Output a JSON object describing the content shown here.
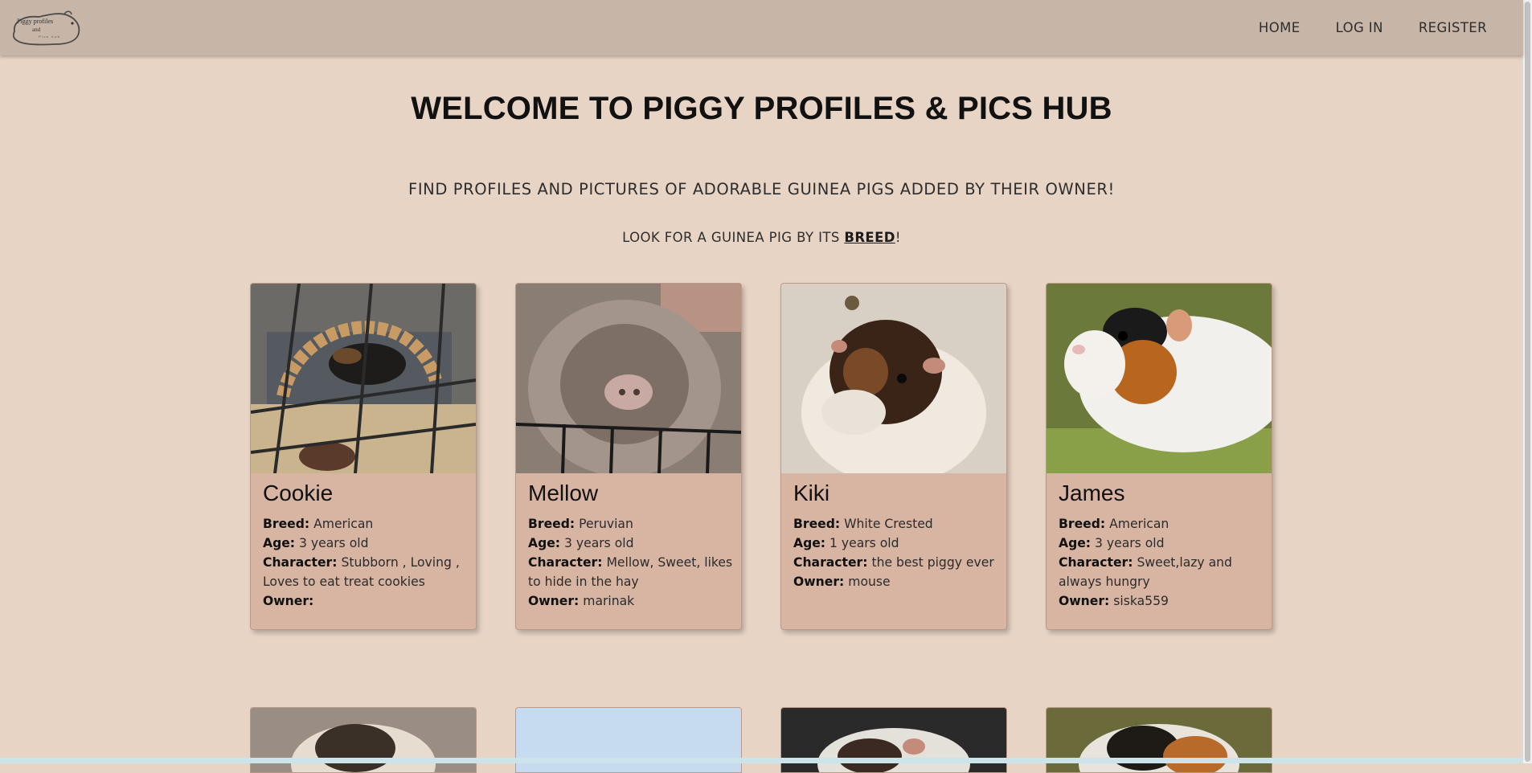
{
  "nav": {
    "logo_text": [
      "Piggy profiles",
      "and",
      "Pics hub"
    ],
    "links": [
      "HOME",
      "LOG IN",
      "REGISTER"
    ]
  },
  "hero": {
    "title": "WELCOME TO PIGGY PROFILES & PICS HUB",
    "subtitle": "FIND PROFILES AND PICTURES OF ADORABLE GUINEA PIGS ADDED BY THEIR OWNER!",
    "breed_prefix": "LOOK FOR A GUINEA PIG BY ITS ",
    "breed_link": "BREED",
    "breed_suffix": "!"
  },
  "labels": {
    "breed": "Breed:",
    "age": "Age:",
    "character": "Character:",
    "owner": "Owner:"
  },
  "cards": [
    {
      "name": "Cookie",
      "breed": "American",
      "age": "3 years old",
      "character": "Stubborn , Loving , Loves to eat treat cookies",
      "owner": ""
    },
    {
      "name": "Mellow",
      "breed": "Peruvian",
      "age": "3 years old",
      "character": "Mellow, Sweet, likes to hide in the hay",
      "owner": "marinak"
    },
    {
      "name": "Kiki",
      "breed": "White Crested",
      "age": "1 years old",
      "character": "the best piggy ever",
      "owner": "mouse"
    },
    {
      "name": "James",
      "breed": "American",
      "age": "3 years old",
      "character": "Sweet,lazy and always hungry",
      "owner": "siska559"
    }
  ],
  "colors": {
    "background": "#e8d4c5",
    "navbar": "#c7b5a7",
    "card": "#d8b4a2"
  }
}
